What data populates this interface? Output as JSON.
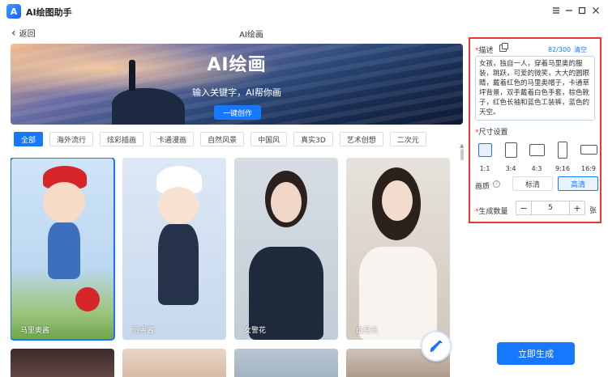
{
  "app": {
    "title": "AI绘图助手",
    "logo_letter": "A"
  },
  "window_controls": [
    "menu-icon",
    "minimize-icon",
    "maximize-icon",
    "close-icon"
  ],
  "header": {
    "back_label": "返回",
    "page_title": "AI绘画"
  },
  "banner": {
    "title": "AI绘画",
    "subtitle": "输入关键字，AI帮你画",
    "button_label": "一键创作"
  },
  "tabs": [
    {
      "label": "全部",
      "active": true
    },
    {
      "label": "海外流行",
      "active": false
    },
    {
      "label": "炫彩插画",
      "active": false
    },
    {
      "label": "卡通漫画",
      "active": false
    },
    {
      "label": "自然风景",
      "active": false
    },
    {
      "label": "中国风",
      "active": false
    },
    {
      "label": "真实3D",
      "active": false
    },
    {
      "label": "艺术创想",
      "active": false
    },
    {
      "label": "二次元",
      "active": false
    }
  ],
  "gallery": [
    {
      "caption": "马里奥酱",
      "selected": true
    },
    {
      "caption": "滑雪酱",
      "selected": false
    },
    {
      "caption": "女警花",
      "selected": false
    },
    {
      "caption": "白月光",
      "selected": false
    }
  ],
  "panel": {
    "description": {
      "label": "描述",
      "char_count": "82/300",
      "clear_label": "清空",
      "text": "女孩，独自一人，穿着马里奥的服装，跳跃，可爱的微笑，大大的圆眼睛，戴着红色的马里奥帽子，卡通草坪背景，双手戴着白色手套，棕色靴子，红色长袖和蓝色工装裤，蓝色的天空。"
    },
    "size": {
      "label": "尺寸设置",
      "options": [
        {
          "label": "1:1",
          "active": true
        },
        {
          "label": "3:4",
          "active": false
        },
        {
          "label": "4:3",
          "active": false
        },
        {
          "label": "9:16",
          "active": false
        },
        {
          "label": "16:9",
          "active": false
        }
      ]
    },
    "quality": {
      "label": "画质",
      "help": "?",
      "options": [
        {
          "label": "标清",
          "active": false
        },
        {
          "label": "高清",
          "active": true
        }
      ]
    },
    "count": {
      "label": "生成数量",
      "minus": "−",
      "plus": "+",
      "value": "5",
      "unit": "张"
    }
  },
  "generate_button": "立即生成",
  "colors": {
    "accent": "#1677ff",
    "panel_border": "#e53935"
  }
}
